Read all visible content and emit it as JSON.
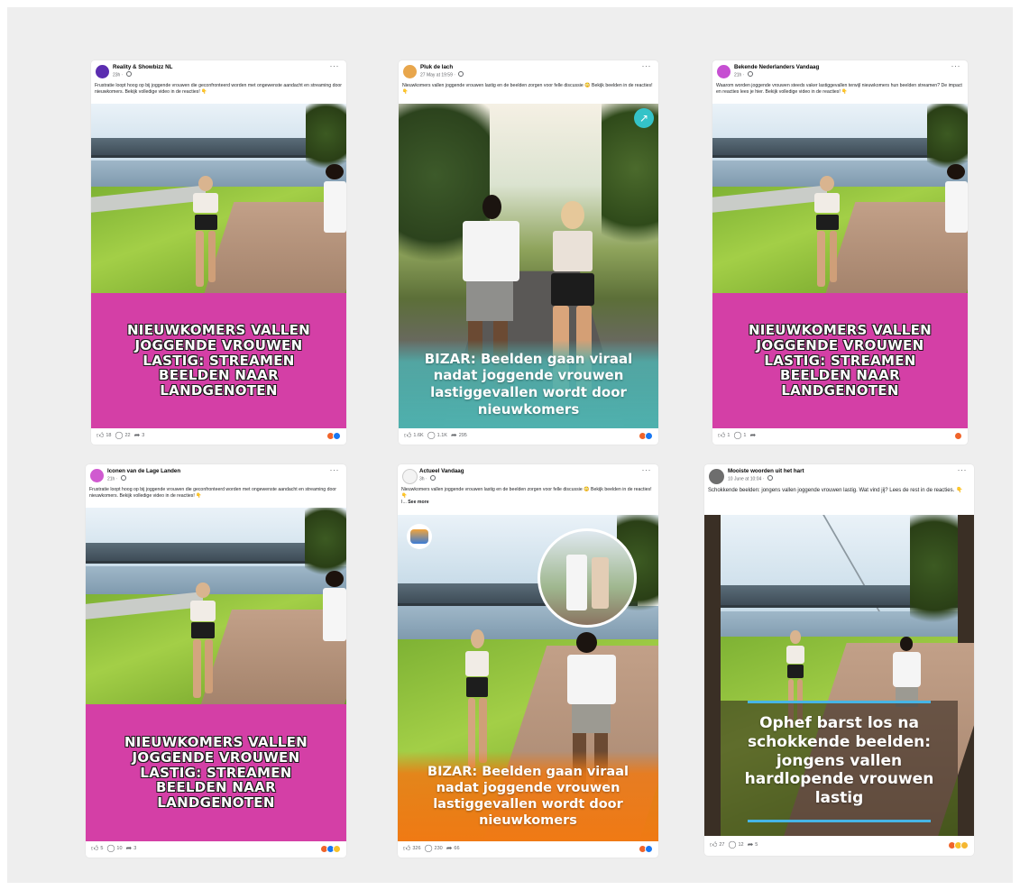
{
  "posts": [
    {
      "page_name": "Reality & Showbizz NL",
      "time": "23h",
      "caption": "Frustratie loopt hoog op bij joggende vrouwen die geconfronteerd worden met ongewenste aandacht en streaming door nieuwkomers. Bekijk volledige video in de reacties! 👇",
      "overlay": "NIEUWKOMERS VALLEN JOGGENDE VROUWEN LASTIG: STREAMEN BEELDEN NAAR LANDGENOTEN",
      "likes": "18",
      "comments": "22",
      "shares": "3"
    },
    {
      "page_name": "Pluk de lach",
      "time": "27 May at 19:59",
      "caption": "Nieuwkomers vallen joggende vrouwen lastig en de beelden zorgen voor felle discussie 😳 Bekijk beelden in de reacties! 👇",
      "overlay": "BIZAR: Beelden gaan viraal nadat joggende vrouwen lastiggevallen wordt door nieuwkomers",
      "likes": "1.6K",
      "comments": "1.1K",
      "shares": "295"
    },
    {
      "page_name": "Bekende Nederlanders Vandaag",
      "time": "21h",
      "caption": "Waarom worden joggende vrouwen steeds vaker lastiggevallen terwijl nieuwkomers hun beelden streamen? De impact en reacties lees je hier. Bekijk volledige video in de reacties! 👇",
      "overlay": "NIEUWKOMERS VALLEN JOGGENDE VROUWEN LASTIG: STREAMEN BEELDEN NAAR LANDGENOTEN",
      "likes": "1",
      "comments": "1",
      "shares": ""
    },
    {
      "page_name": "Iconen van de Lage Landen",
      "time": "21h",
      "caption": "Frustratie loopt hoog op bij joggende vrouwen die geconfronteerd worden met ongewenste aandacht en streaming door nieuwkomers. Bekijk volledige video in de reacties! 👇",
      "overlay": "NIEUWKOMERS VALLEN JOGGENDE VROUWEN LASTIG: STREAMEN BEELDEN NAAR LANDGENOTEN",
      "likes": "5",
      "comments": "10",
      "shares": "3"
    },
    {
      "page_name": "Actueel Vandaag",
      "time": "3h",
      "caption": "Nieuwkomers vallen joggende vrouwen lastig en de beelden zorgen voor felle discussie 😳 Bekijk beelden in de reacties! 👇",
      "caption_tail": "I...",
      "see_more": "See more",
      "overlay": "BIZAR: Beelden gaan viraal nadat joggende vrouwen lastiggevallen wordt door nieuwkomers",
      "likes": "326",
      "comments": "230",
      "shares": "66"
    },
    {
      "page_name": "Mooiste woorden uit het hart",
      "time": "10 June at 10:04",
      "caption": "Schokkende beelden: jongens vallen joggende vrouwen lastig. Wat vind jij? Lees de rest in de reacties. 👇",
      "overlay": "Ophef barst los na schokkende beelden: jongens vallen hardlopende vrouwen lastig",
      "likes": "27",
      "comments": "12",
      "shares": "5"
    }
  ],
  "icons": {
    "like": "thumbs-up-icon",
    "comment": "comment-icon",
    "share": "share-icon",
    "more": "more-options-icon",
    "privacy": "globe-icon"
  },
  "colors": {
    "pink_banner": "#d43fa6",
    "teal_banner": "#4fb1ae",
    "orange_banner": "#f07a14",
    "facebook_blue": "#1877f2"
  }
}
